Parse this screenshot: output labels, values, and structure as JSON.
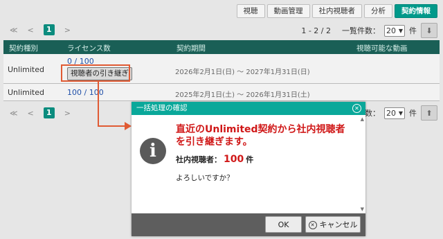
{
  "tabs": [
    {
      "label": "視聴"
    },
    {
      "label": "動画管理"
    },
    {
      "label": "社内視聴者"
    },
    {
      "label": "分析"
    },
    {
      "label": "契約情報"
    }
  ],
  "pager": {
    "first": "≪",
    "prev": "<",
    "current": "1",
    "next": ">"
  },
  "pageinfo": {
    "range": "1 - 2 / 2",
    "per_page_label": "一覧件数：",
    "per_page_value": "20",
    "unit": "件",
    "sort_down_icon": "arrow-down-icon",
    "sort_up_icon": "arrow-up-icon"
  },
  "table": {
    "headers": [
      "契約種別",
      "ライセンス数",
      "契約期間",
      "視聴可能な動画"
    ],
    "rows": [
      {
        "type": "Unlimited",
        "licenses": "0 / 100",
        "action": "視聴者の引き継ぎ",
        "period": "2026年2月1日(日) ～ 2027年1月31日(日)"
      },
      {
        "type": "Unlimited",
        "licenses": "100 / 100",
        "period": "2025年2月1日(土) ～ 2026年1月31日(土)"
      }
    ]
  },
  "dialog": {
    "title": "一括処理の確認",
    "headline": "直近のUnlimited契約から社内視聴者を引き継ぎます。",
    "count_label": "社内視聴者：",
    "count_value": "100",
    "count_unit": "件",
    "question": "よろしいですか？",
    "ok": "OK",
    "cancel": "キャンセル",
    "icon": "info-icon"
  },
  "colors": {
    "accent": "#0aa89a",
    "header": "#1a5f56",
    "alert": "#d01818",
    "callout": "#e05a33"
  }
}
